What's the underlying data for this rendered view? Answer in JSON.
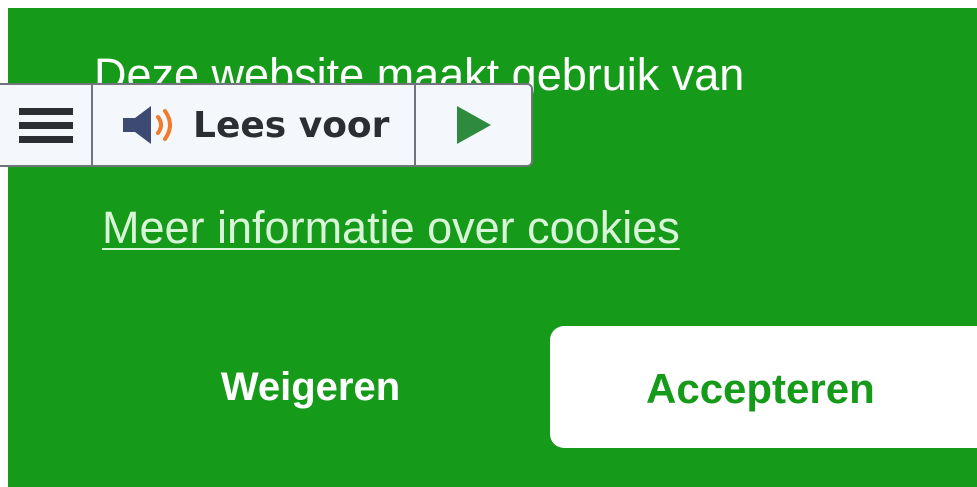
{
  "banner": {
    "text": "Deze website maakt gebruik van",
    "more_info_link": "Meer informatie over cookies",
    "reject_label": "Weigeren",
    "accept_label": "Accepteren",
    "colors": {
      "background": "#169a1a",
      "text": "#ffffff",
      "accept_text": "#169a1a"
    }
  },
  "readspeaker": {
    "menu_icon": "hamburger-menu-icon",
    "speaker_icon": "speaker-icon",
    "listen_label": "Lees voor",
    "play_icon": "play-icon",
    "colors": {
      "background": "#f4f7fb",
      "border": "#70757c",
      "icon_dark": "#3d4a73",
      "sound_waves": "#f07b2c",
      "play": "#2e8b3e"
    }
  }
}
